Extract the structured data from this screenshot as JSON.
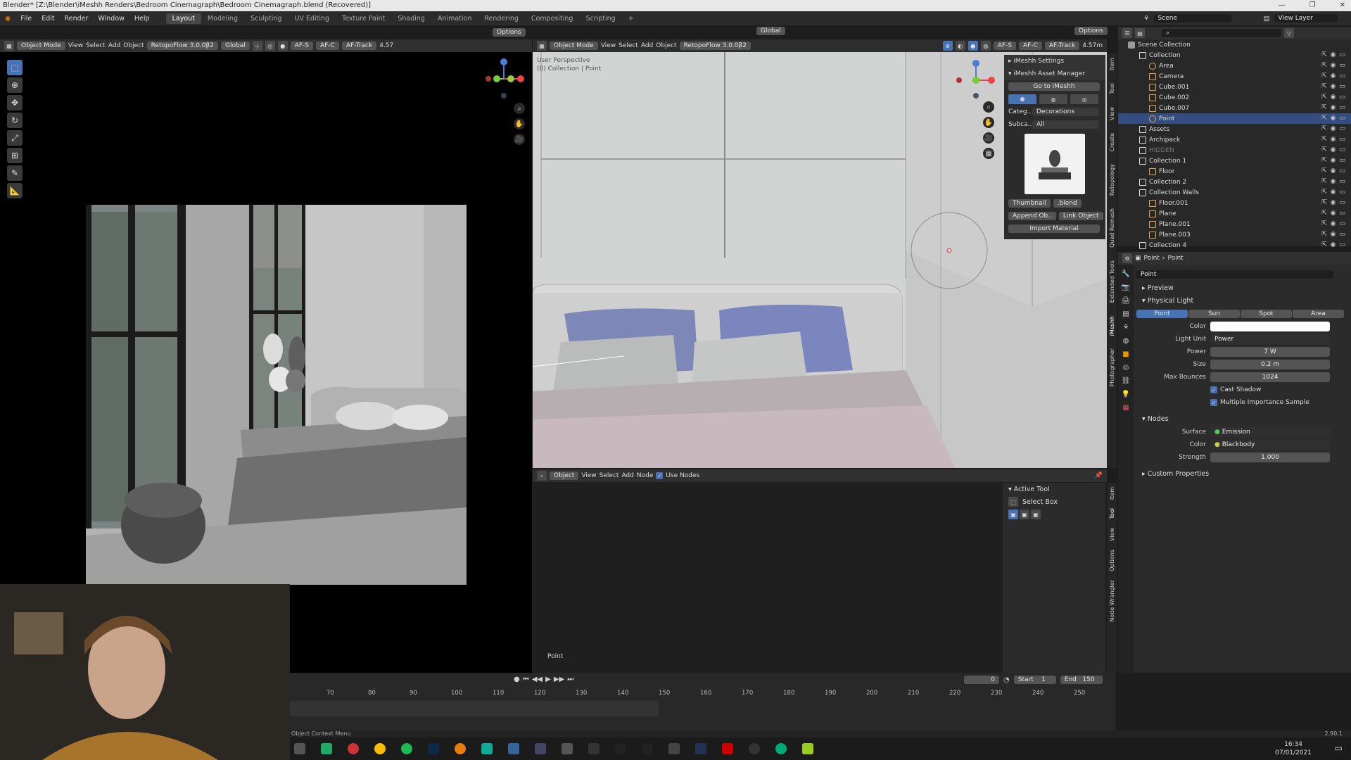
{
  "titlebar": {
    "title": "Blender* [Z:\\Blender\\iMeshh Renders\\Bedroom Cinemagraph\\Bedroom Cinemagraph.blend (Recovered)]"
  },
  "menu": [
    "File",
    "Edit",
    "Render",
    "Window",
    "Help"
  ],
  "workspaces": [
    "Layout",
    "Modeling",
    "Sculpting",
    "UV Editing",
    "Texture Paint",
    "Shading",
    "Animation",
    "Rendering",
    "Compositing",
    "Scripting"
  ],
  "active_workspace": "Layout",
  "scene": {
    "label": "Scene",
    "view_layer": "View Layer"
  },
  "left_view": {
    "mode": "Object Mode",
    "menus": [
      "View",
      "Select",
      "Add",
      "Object"
    ],
    "addon": "RetopoFlow 3.0.0β2",
    "transform": "Global",
    "af": [
      "AF-S",
      "AF-C",
      "AF-Track"
    ],
    "value": "4.57",
    "options": "Options"
  },
  "right_view": {
    "mode": "Object Mode",
    "menus": [
      "View",
      "Select",
      "Add",
      "Object"
    ],
    "addon": "RetopoFlow 3.0.0β2",
    "transform": "Global",
    "af": [
      "AF-S",
      "AF-C",
      "AF-Track"
    ],
    "distance": "4.57m",
    "options": "Options",
    "overlay_line1": "User Perspective",
    "overlay_line2": "(0) Collection | Point"
  },
  "imeshh": {
    "title1": "iMeshh Settings",
    "title2": "iMeshh Asset Manager",
    "goto": "Go to iMeshh",
    "category_label": "Categ..",
    "category": "Decorations",
    "subcategory_label": "Subca..",
    "subcategory": "All",
    "thumbnail": "Thumbnail",
    "blend": ".blend",
    "append": "Append Ob..",
    "link": "Link Object",
    "import_material": "Import Material"
  },
  "side_tabs_right": [
    "Item",
    "Tool",
    "View",
    "Create",
    "Retopology",
    "Quad Remesh",
    "Extended Tools",
    "iMeshh",
    "Photographer"
  ],
  "node_editor": {
    "type": "Object",
    "menus": [
      "View",
      "Select",
      "Add",
      "Node"
    ],
    "use_nodes": "Use Nodes",
    "active_tool_title": "Active Tool",
    "active_tool": "Select Box",
    "footer_label": "Point",
    "side_tabs": [
      "Item",
      "Tool",
      "View",
      "Options",
      "Node Wrangler"
    ]
  },
  "outliner": {
    "root": "Scene Collection",
    "items": [
      {
        "label": "Collection",
        "depth": 0,
        "icon": "collection-icon"
      },
      {
        "label": "Area",
        "depth": 1,
        "icon": "light-icon"
      },
      {
        "label": "Camera",
        "depth": 1,
        "icon": "camera-icon"
      },
      {
        "label": "Cube.001",
        "depth": 1,
        "icon": "mesh-icon"
      },
      {
        "label": "Cube.002",
        "depth": 1,
        "icon": "mesh-icon"
      },
      {
        "label": "Cube.007",
        "depth": 1,
        "icon": "mesh-icon"
      },
      {
        "label": "Point",
        "depth": 1,
        "icon": "light-icon",
        "selected": true
      },
      {
        "label": "Assets",
        "depth": 0,
        "icon": "collection-icon"
      },
      {
        "label": "Archipack",
        "depth": 0,
        "icon": "collection-icon"
      },
      {
        "label": "HIDDEN",
        "depth": 0,
        "icon": "collection-icon",
        "dim": true
      },
      {
        "label": "Collection 1",
        "depth": 0,
        "icon": "collection-icon"
      },
      {
        "label": "Floor",
        "depth": 1,
        "icon": "mesh-icon"
      },
      {
        "label": "Collection 2",
        "depth": 0,
        "icon": "collection-icon"
      },
      {
        "label": "Collection Walls",
        "depth": 0,
        "icon": "collection-icon"
      },
      {
        "label": "Floor.001",
        "depth": 1,
        "icon": "mesh-icon"
      },
      {
        "label": "Plane",
        "depth": 1,
        "icon": "mesh-icon"
      },
      {
        "label": "Plane.001",
        "depth": 1,
        "icon": "mesh-icon"
      },
      {
        "label": "Plane.003",
        "depth": 1,
        "icon": "mesh-icon"
      },
      {
        "label": "Collection 4",
        "depth": 0,
        "icon": "collection-icon"
      }
    ]
  },
  "properties": {
    "breadcrumb1": "Point",
    "breadcrumb2": "Point",
    "datablock": "Point",
    "preview": "Preview",
    "physical_light": "Physical Light",
    "light_types": [
      "Point",
      "Sun",
      "Spot",
      "Area"
    ],
    "active_type": "Point",
    "fields": [
      {
        "label": "Color",
        "value": ""
      },
      {
        "label": "Light Unit",
        "value": "Power"
      },
      {
        "label": "Power",
        "value": "7 W"
      },
      {
        "label": "Size",
        "value": "0.2 m"
      },
      {
        "label": "Max Bounces",
        "value": "1024"
      }
    ],
    "cast_shadow": "Cast Shadow",
    "mis": "Multiple Importance Sample",
    "nodes": "Nodes",
    "surface_label": "Surface",
    "surface": "Emission",
    "color_label": "Color",
    "color": "Blackbody",
    "strength_label": "Strength",
    "strength": "1.000",
    "custom_properties": "Custom Properties"
  },
  "timeline": {
    "frame": "0",
    "start_label": "Start",
    "start": "1",
    "end_label": "End",
    "end": "150",
    "ticks": [
      "70",
      "80",
      "90",
      "100",
      "110",
      "120",
      "130",
      "140",
      "150",
      "160",
      "170",
      "180",
      "190",
      "200",
      "210",
      "220",
      "230",
      "240",
      "250"
    ]
  },
  "status": {
    "left": "Object Context Menu",
    "version": "2.90.1"
  },
  "clock": {
    "time": "16:34",
    "date": "07/01/2021"
  },
  "colors": {
    "accent": "#4772b3",
    "selected_row": "#334d80",
    "wall": "#d6d6d6",
    "pillow_blue": "#7d87b8"
  }
}
